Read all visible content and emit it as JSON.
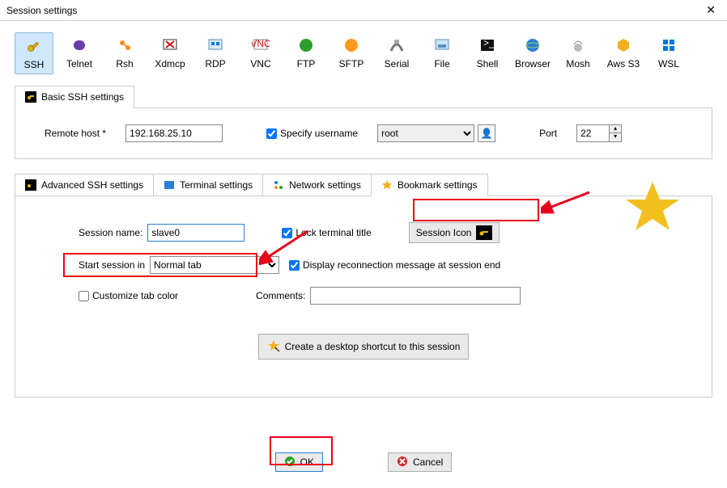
{
  "window": {
    "title": "Session settings"
  },
  "protocols": [
    {
      "label": "SSH",
      "name": "proto-ssh",
      "selected": true
    },
    {
      "label": "Telnet",
      "name": "proto-telnet"
    },
    {
      "label": "Rsh",
      "name": "proto-rsh"
    },
    {
      "label": "Xdmcp",
      "name": "proto-xdmcp"
    },
    {
      "label": "RDP",
      "name": "proto-rdp"
    },
    {
      "label": "VNC",
      "name": "proto-vnc"
    },
    {
      "label": "FTP",
      "name": "proto-ftp"
    },
    {
      "label": "SFTP",
      "name": "proto-sftp"
    },
    {
      "label": "Serial",
      "name": "proto-serial"
    },
    {
      "label": "File",
      "name": "proto-file"
    },
    {
      "label": "Shell",
      "name": "proto-shell"
    },
    {
      "label": "Browser",
      "name": "proto-browser"
    },
    {
      "label": "Mosh",
      "name": "proto-mosh"
    },
    {
      "label": "Aws S3",
      "name": "proto-aws-s3"
    },
    {
      "label": "WSL",
      "name": "proto-wsl"
    }
  ],
  "basic_tab": {
    "label": "Basic SSH settings"
  },
  "basic": {
    "remote_host_label": "Remote host *",
    "remote_host_value": "192.168.25.10",
    "specify_username_label": "Specify username",
    "specify_username_checked": true,
    "username_value": "root",
    "port_label": "Port",
    "port_value": "22"
  },
  "subtabs": {
    "adv_label": "Advanced SSH settings",
    "term_label": "Terminal settings",
    "net_label": "Network settings",
    "bookmark_label": "Bookmark settings"
  },
  "bookmark": {
    "session_name_label": "Session name:",
    "session_name_value": "slave0",
    "lock_title_label": "Lock terminal title",
    "lock_title_checked": true,
    "session_icon_label": "Session Icon",
    "start_session_label": "Start session in",
    "start_session_value": "Normal tab",
    "display_reconn_label": "Display reconnection message at session end",
    "display_reconn_checked": true,
    "customize_color_label": "Customize tab color",
    "customize_color_checked": false,
    "comments_label": "Comments:",
    "comments_value": "",
    "shortcut_label": "Create a desktop shortcut to this session"
  },
  "buttons": {
    "ok": "OK",
    "cancel": "Cancel"
  }
}
